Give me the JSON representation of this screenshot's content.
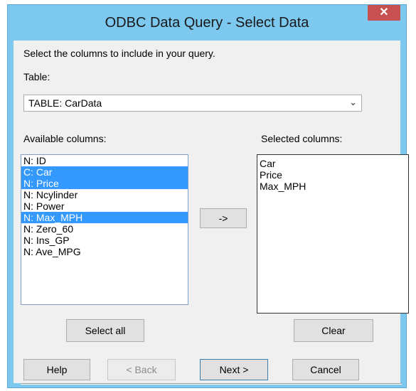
{
  "window": {
    "title": "ODBC Data Query - Select Data",
    "close_glyph": "✕"
  },
  "instructions": "Select the columns to include in your query.",
  "table": {
    "label": "Table:",
    "selected": "TABLE: CarData"
  },
  "available": {
    "label": "Available columns:",
    "items": [
      {
        "text": "N: ID",
        "selected": false
      },
      {
        "text": "C: Car",
        "selected": true
      },
      {
        "text": "N: Price",
        "selected": true
      },
      {
        "text": "N: Ncylinder",
        "selected": false
      },
      {
        "text": "N: Power",
        "selected": false
      },
      {
        "text": "N: Max_MPH",
        "selected": true
      },
      {
        "text": "N: Zero_60",
        "selected": false
      },
      {
        "text": "N: Ins_GP",
        "selected": false
      },
      {
        "text": "N: Ave_MPG",
        "selected": false
      }
    ]
  },
  "selected_columns": {
    "label": "Selected columns:",
    "items": [
      "Car",
      "Price",
      "Max_MPH"
    ]
  },
  "buttons": {
    "add": "->",
    "select_all": "Select all",
    "clear": "Clear",
    "help": "Help",
    "back": "< Back",
    "next": "Next >",
    "cancel": "Cancel"
  },
  "colors": {
    "title_bar": "#7cc8ef",
    "selection": "#3399ff",
    "close_button": "#c75050"
  }
}
